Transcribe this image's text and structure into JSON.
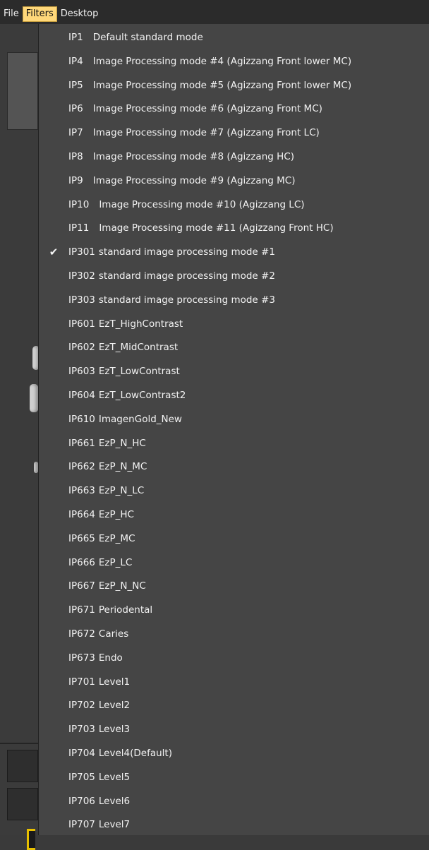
{
  "menubar": {
    "file": "File",
    "filters": "Filters",
    "desktop": "Desktop"
  },
  "filters_menu": {
    "checked_icon": "checkmark-icon",
    "items": [
      {
        "code": "IP1",
        "label": "Default standard mode",
        "checked": false,
        "gap": 20
      },
      {
        "code": "IP4",
        "label": "Image Processing mode #4 (Agizzang Front lower MC)",
        "checked": false,
        "gap": 20
      },
      {
        "code": "IP5",
        "label": "Image Processing mode #5 (Agizzang Front lower MC)",
        "checked": false,
        "gap": 20
      },
      {
        "code": "IP6",
        "label": "Image Processing mode #6 (Agizzang Front MC)",
        "checked": false,
        "gap": 20
      },
      {
        "code": "IP7",
        "label": "Image Processing mode #7 (Agizzang Front LC)",
        "checked": false,
        "gap": 20
      },
      {
        "code": "IP8",
        "label": "Image Processing mode #8 (Agizzang HC)",
        "checked": false,
        "gap": 20
      },
      {
        "code": "IP9",
        "label": "Image Processing mode #9 (Agizzang MC)",
        "checked": false,
        "gap": 20
      },
      {
        "code": "IP10",
        "label": "Image Processing mode #10 (Agizzang LC)",
        "checked": false,
        "gap": 20
      },
      {
        "code": "IP11",
        "label": "Image Processing mode #11 (Agizzang Front HC)",
        "checked": false,
        "gap": 20
      },
      {
        "code": "IP301",
        "label": "standard image processing mode #1",
        "checked": true
      },
      {
        "code": "IP302",
        "label": "standard image processing mode #2",
        "checked": false
      },
      {
        "code": "IP303",
        "label": "standard image processing mode #3",
        "checked": false
      },
      {
        "code": "IP601",
        "label": "EzT_HighContrast",
        "checked": false
      },
      {
        "code": "IP602",
        "label": "EzT_MidContrast",
        "checked": false
      },
      {
        "code": "IP603",
        "label": "EzT_LowContrast",
        "checked": false
      },
      {
        "code": "IP604",
        "label": "EzT_LowContrast2",
        "checked": false
      },
      {
        "code": "IP610",
        "label": "ImagenGold_New",
        "checked": false
      },
      {
        "code": "IP661",
        "label": "EzP_N_HC",
        "checked": false
      },
      {
        "code": "IP662",
        "label": "EzP_N_MC",
        "checked": false
      },
      {
        "code": "IP663",
        "label": "EzP_N_LC",
        "checked": false
      },
      {
        "code": "IP664",
        "label": "EzP_HC",
        "checked": false
      },
      {
        "code": "IP665",
        "label": "EzP_MC",
        "checked": false
      },
      {
        "code": "IP666",
        "label": "EzP_LC",
        "checked": false
      },
      {
        "code": "IP667",
        "label": "EzP_N_NC",
        "checked": false
      },
      {
        "code": "IP671",
        "label": "Periodental",
        "checked": false
      },
      {
        "code": "IP672",
        "label": "Caries",
        "checked": false
      },
      {
        "code": "IP673",
        "label": "Endo",
        "checked": false
      },
      {
        "code": "IP701",
        "label": "Level1",
        "checked": false
      },
      {
        "code": "IP702",
        "label": "Level2",
        "checked": false
      },
      {
        "code": "IP703",
        "label": "Level3",
        "checked": false
      },
      {
        "code": "IP704",
        "label": "Level4(Default)",
        "checked": false
      },
      {
        "code": "IP705",
        "label": "Level5",
        "checked": false
      },
      {
        "code": "IP706",
        "label": "Level6",
        "checked": false
      },
      {
        "code": "IP707",
        "label": "Level7",
        "checked": false
      }
    ]
  }
}
